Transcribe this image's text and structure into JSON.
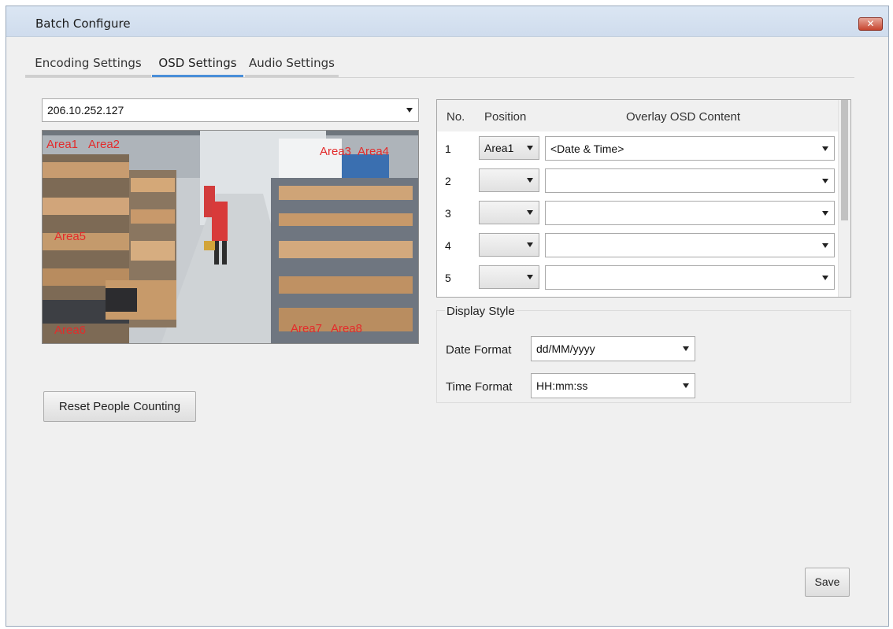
{
  "window": {
    "title": "Batch Configure",
    "close_glyph": "✕"
  },
  "tabs": [
    {
      "label": "Encoding Settings",
      "active": false
    },
    {
      "label": "OSD Settings",
      "active": true
    },
    {
      "label": "Audio Settings",
      "active": false
    }
  ],
  "device": {
    "selected": "206.10.252.127"
  },
  "preview": {
    "areas": [
      "Area1",
      "Area2",
      "Area3",
      "Area4",
      "Area5",
      "Area6",
      "Area7",
      "Area8"
    ],
    "label_color": "#e32b2b"
  },
  "reset_button": "Reset People Counting",
  "osd_table": {
    "headers": {
      "no": "No.",
      "position": "Position",
      "content": "Overlay OSD Content"
    },
    "rows": [
      {
        "no": "1",
        "position": "Area1",
        "content": "<Date & Time>"
      },
      {
        "no": "2",
        "position": "",
        "content": ""
      },
      {
        "no": "3",
        "position": "",
        "content": ""
      },
      {
        "no": "4",
        "position": "",
        "content": ""
      },
      {
        "no": "5",
        "position": "",
        "content": ""
      }
    ]
  },
  "display_style": {
    "legend": "Display Style",
    "date_format_label": "Date Format",
    "date_format_value": "dd/MM/yyyy",
    "time_format_label": "Time Format",
    "time_format_value": "HH:mm:ss"
  },
  "save_button": "Save",
  "accent_color": "#4a8fd9"
}
